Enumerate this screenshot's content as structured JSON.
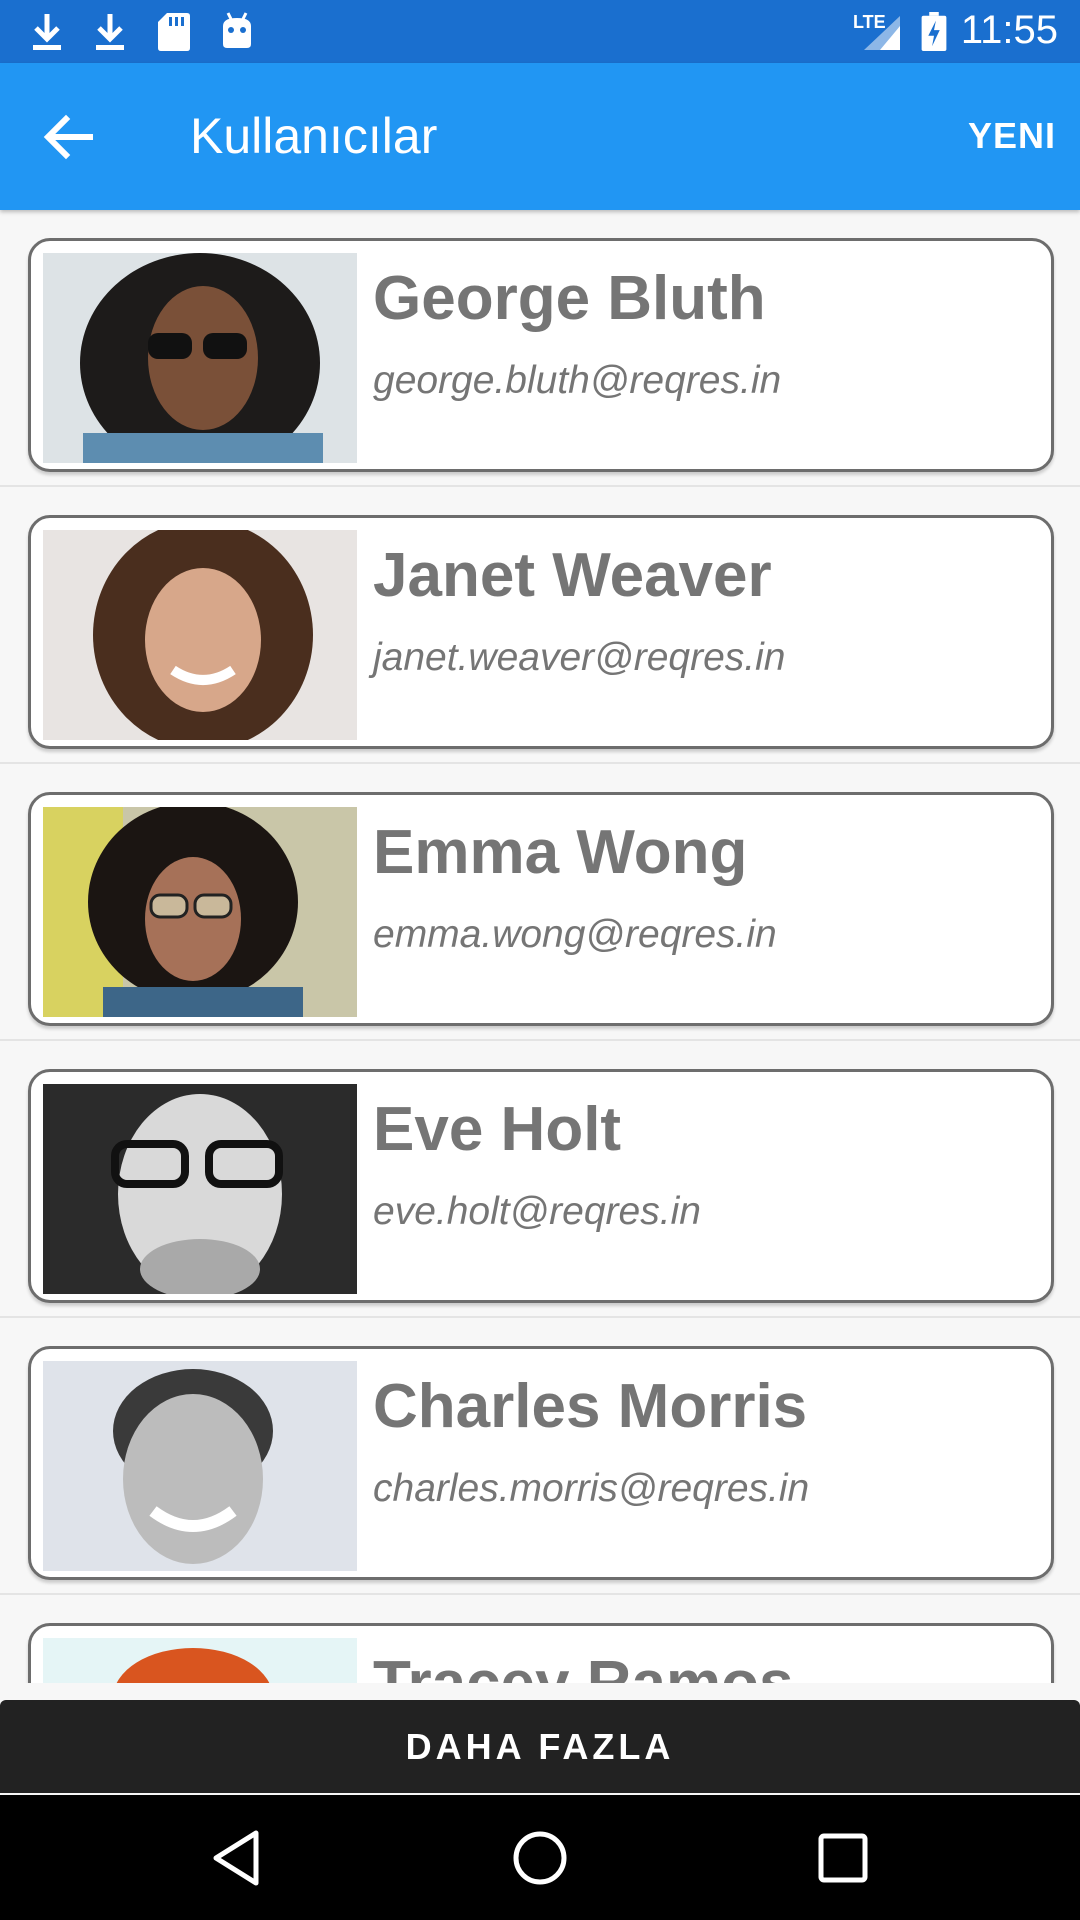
{
  "status_bar": {
    "time": "11:55",
    "network": "LTE",
    "icons": [
      "download-icon",
      "download-icon",
      "sd-card-icon",
      "android-icon",
      "lte-signal-icon",
      "battery-charging-icon"
    ]
  },
  "app_bar": {
    "title": "Kullanıcılar",
    "action_label": "YENI",
    "background": "#2196f3"
  },
  "users": [
    {
      "name": "George Bluth",
      "email": "george.bluth@reqres.in"
    },
    {
      "name": "Janet Weaver",
      "email": "janet.weaver@reqres.in"
    },
    {
      "name": "Emma Wong",
      "email": "emma.wong@reqres.in"
    },
    {
      "name": "Eve Holt",
      "email": "eve.holt@reqres.in"
    },
    {
      "name": "Charles Morris",
      "email": "charles.morris@reqres.in"
    },
    {
      "name": "Tracey Ramos",
      "email": ""
    }
  ],
  "footer": {
    "more_label": "DAHA FAZLA"
  },
  "colors": {
    "status_bar": "#1a6fcf",
    "app_bar": "#2196f3",
    "text_secondary": "#757575",
    "more_button": "#222222"
  }
}
